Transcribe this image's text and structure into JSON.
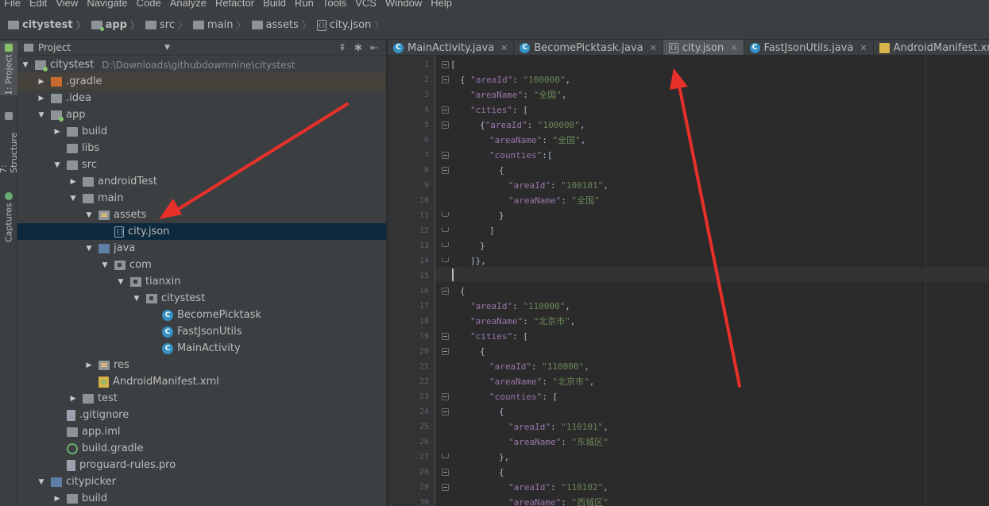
{
  "menu": [
    "File",
    "Edit",
    "View",
    "Navigate",
    "Code",
    "Analyze",
    "Refactor",
    "Build",
    "Run",
    "Tools",
    "VCS",
    "Window",
    "Help"
  ],
  "breadcrumbs": [
    "citystest",
    "app",
    "src",
    "main",
    "assets",
    "city.json"
  ],
  "side_tabs": {
    "project": "1: Project",
    "structure": "7: Structure",
    "captures": "Captures"
  },
  "project_panel": {
    "title": "Project"
  },
  "tree": [
    {
      "label": "citystest",
      "path": "D:\\Downloads\\githubdowmnine\\citystest"
    },
    {
      "label": ".gradle"
    },
    {
      "label": ".idea"
    },
    {
      "label": "app"
    },
    {
      "label": "build"
    },
    {
      "label": "libs"
    },
    {
      "label": "src"
    },
    {
      "label": "androidTest"
    },
    {
      "label": "main"
    },
    {
      "label": "assets"
    },
    {
      "label": "city.json"
    },
    {
      "label": "java"
    },
    {
      "label": "com"
    },
    {
      "label": "tianxin"
    },
    {
      "label": "citystest"
    },
    {
      "label": "BecomePicktask"
    },
    {
      "label": "FastJsonUtils"
    },
    {
      "label": "MainActivity"
    },
    {
      "label": "res"
    },
    {
      "label": "AndroidManifest.xml"
    },
    {
      "label": "test"
    },
    {
      "label": ".gitignore"
    },
    {
      "label": "app.iml"
    },
    {
      "label": "build.gradle"
    },
    {
      "label": "proguard-rules.pro"
    },
    {
      "label": "citypicker"
    },
    {
      "label": "build"
    }
  ],
  "tabs": [
    {
      "label": "MainActivity.java"
    },
    {
      "label": "BecomePicktask.java"
    },
    {
      "label": "city.json"
    },
    {
      "label": "FastJsonUtils.java"
    },
    {
      "label": "AndroidManifest.xml"
    }
  ],
  "line_numbers": [
    "1",
    "2",
    "3",
    "4",
    "5",
    "6",
    "7",
    "8",
    "9",
    "10",
    "11",
    "12",
    "13",
    "14",
    "15",
    "16",
    "17",
    "18",
    "19",
    "20",
    "21",
    "22",
    "23",
    "24",
    "25",
    "26",
    "27",
    "28",
    "29",
    "30"
  ],
  "code": [
    {
      "p": "[",
      "k": "",
      "s": "",
      "e": ""
    },
    {
      "p": "{ ",
      "k": "\"areaId\"",
      "s": "\"100000\"",
      "e": ","
    },
    {
      "p": "",
      "k": "\"areaName\"",
      "s": "\"全国\"",
      "e": ","
    },
    {
      "p": "",
      "k": "\"cities\"",
      "s": "",
      "e": ": ["
    },
    {
      "p": "{",
      "k": "\"areaId\"",
      "s": "\"100000\"",
      "e": ","
    },
    {
      "p": "",
      "k": "\"areaName\"",
      "s": "\"全国\"",
      "e": ","
    },
    {
      "p": "",
      "k": "\"counties\"",
      "s": "",
      "e": ":["
    },
    {
      "p": "{",
      "k": "",
      "s": "",
      "e": ""
    },
    {
      "p": "",
      "k": "\"areaId\"",
      "s": "\"100101\"",
      "e": ","
    },
    {
      "p": "",
      "k": "\"areaName\"",
      "s": "\"全国\"",
      "e": ""
    },
    {
      "p": "}",
      "k": "",
      "s": "",
      "e": ""
    },
    {
      "p": "]",
      "k": "",
      "s": "",
      "e": ""
    },
    {
      "p": "}",
      "k": "",
      "s": "",
      "e": ""
    },
    {
      "p": "]},",
      "k": "",
      "s": "",
      "e": ""
    },
    {
      "p": "",
      "k": "",
      "s": "",
      "e": ""
    },
    {
      "p": "{",
      "k": "",
      "s": "",
      "e": ""
    },
    {
      "p": "",
      "k": "\"areaId\"",
      "s": "\"110000\"",
      "e": ","
    },
    {
      "p": "",
      "k": "\"areaName\"",
      "s": "\"北京市\"",
      "e": ","
    },
    {
      "p": "",
      "k": "\"cities\"",
      "s": "",
      "e": ": ["
    },
    {
      "p": "{",
      "k": "",
      "s": "",
      "e": ""
    },
    {
      "p": "",
      "k": "\"areaId\"",
      "s": "\"110000\"",
      "e": ","
    },
    {
      "p": "",
      "k": "\"areaName\"",
      "s": "\"北京市\"",
      "e": ","
    },
    {
      "p": "",
      "k": "\"counties\"",
      "s": "",
      "e": ": ["
    },
    {
      "p": "{",
      "k": "",
      "s": "",
      "e": ""
    },
    {
      "p": "",
      "k": "\"areaId\"",
      "s": "\"110101\"",
      "e": ","
    },
    {
      "p": "",
      "k": "\"areaName\"",
      "s": "\"东城区\"",
      "e": ""
    },
    {
      "p": "},",
      "k": "",
      "s": "",
      "e": ""
    },
    {
      "p": "{",
      "k": "",
      "s": "",
      "e": ""
    },
    {
      "p": "",
      "k": "\"areaId\"",
      "s": "\"110102\"",
      "e": ","
    },
    {
      "p": "",
      "k": "\"areaName\"",
      "s": "\"西城区\"",
      "e": ""
    }
  ],
  "colors": {
    "annotation_arrow": "#e8302a",
    "selection": "#0d293e",
    "json_key": "#9876aa",
    "json_string": "#6a8759"
  }
}
